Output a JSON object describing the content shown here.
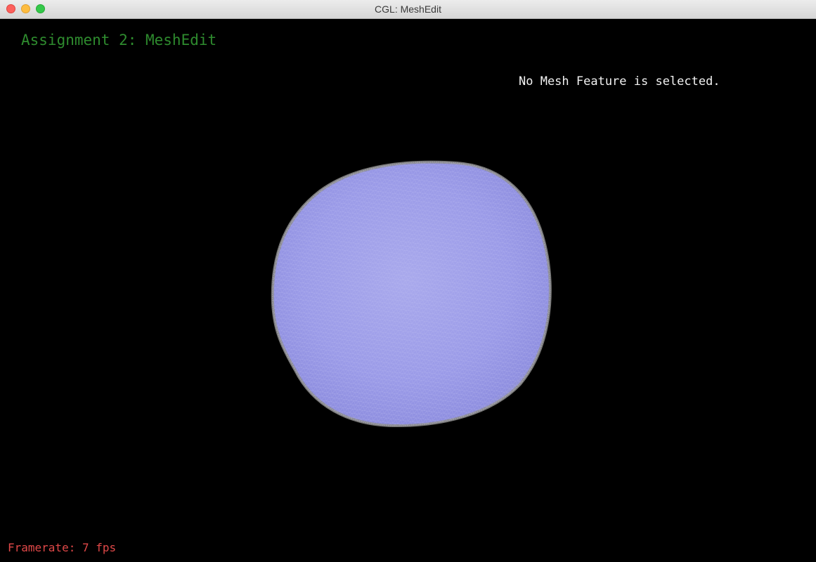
{
  "window": {
    "title": "CGL: MeshEdit"
  },
  "hud": {
    "title": "Assignment 2: MeshEdit",
    "selection_status": "No Mesh Feature is selected.",
    "framerate_label": "Framerate: 7 fps"
  },
  "colors": {
    "title_text": "#2e8b2e",
    "status_text": "#f2f2f2",
    "framerate_text": "#e04848",
    "mesh_fill": "#9a9ae6",
    "mesh_edge": "#8c8c8c"
  }
}
